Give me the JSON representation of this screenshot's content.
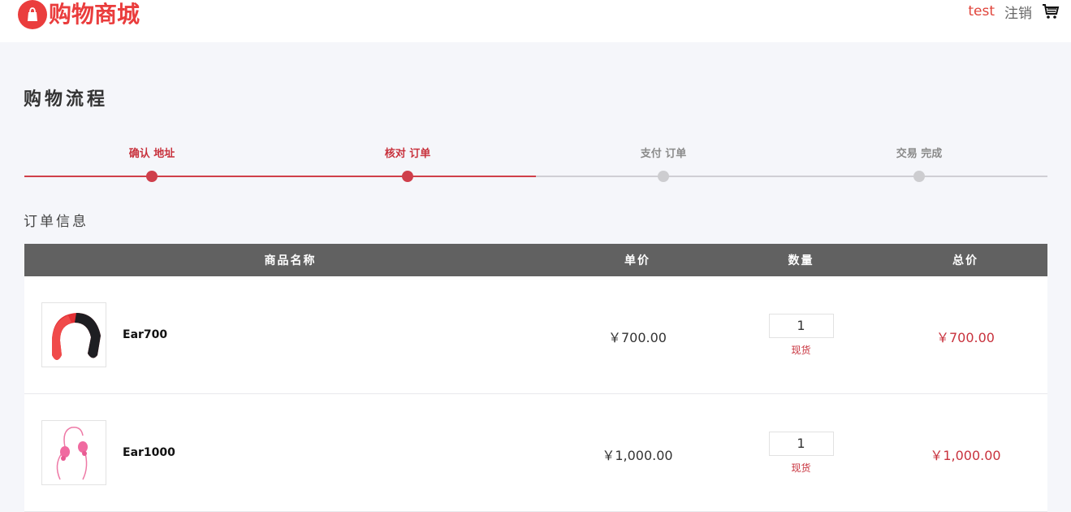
{
  "header": {
    "logo_text": "购物商城",
    "user": "test",
    "logout": "注销",
    "cart_icon": "shopping-cart-icon",
    "brand_color": "#ea3d3d"
  },
  "page": {
    "title": "购物流程",
    "section_title": "订单信息"
  },
  "steps": [
    {
      "label": "确认 地址",
      "status": "done"
    },
    {
      "label": "核对 订单",
      "status": "current"
    },
    {
      "label": "支付 订单",
      "status": "pending"
    },
    {
      "label": "交易 完成",
      "status": "pending"
    }
  ],
  "table": {
    "headers": {
      "name": "商品名称",
      "price": "单价",
      "qty": "数量",
      "total": "总价"
    },
    "rows": [
      {
        "name": "Ear700",
        "image_icon": "red-headphones-image",
        "price": "￥700.00",
        "qty": "1",
        "stock": "现货",
        "total": "￥700.00"
      },
      {
        "name": "Ear1000",
        "image_icon": "pink-earphones-image",
        "price": "￥1,000.00",
        "qty": "1",
        "stock": "现货",
        "total": "￥1,000.00"
      }
    ]
  },
  "colors": {
    "accent": "#c8323d",
    "step_done": "#d0404a",
    "step_pending": "#cfcfd4",
    "table_header": "#616161",
    "background": "#f5f6fa"
  }
}
